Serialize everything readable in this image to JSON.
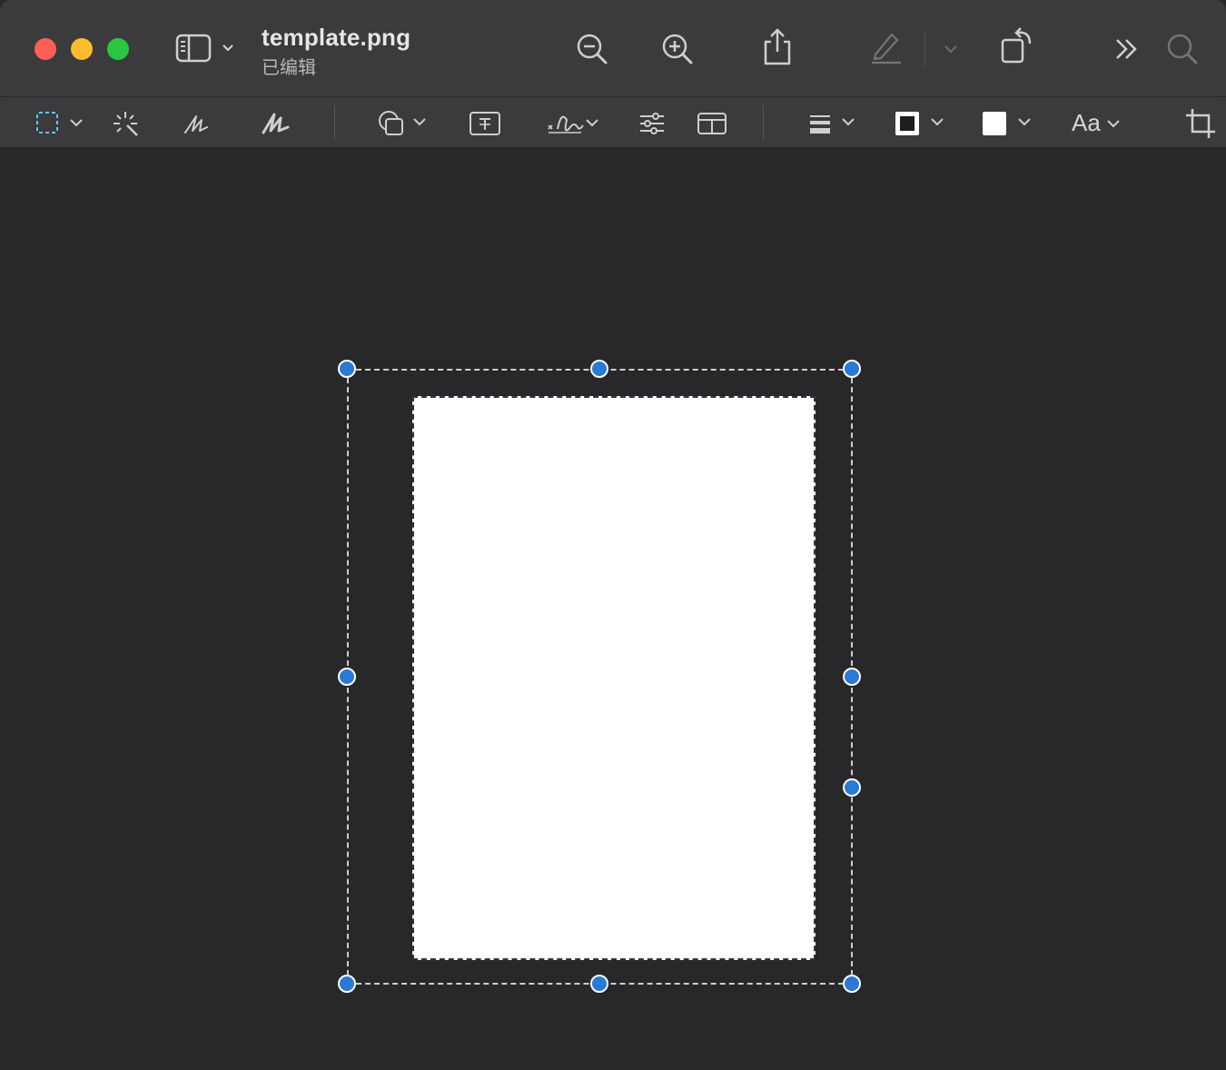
{
  "window": {
    "title": "template.png",
    "subtitle": "已编辑"
  },
  "toolbar": {
    "font_label": "Aa",
    "icons": {
      "sidebar": "sidebar-icon",
      "zoom_out": "zoom-out-icon",
      "zoom_in": "zoom-in-icon",
      "share": "share-icon",
      "markup": "pencil-icon",
      "rotate": "rotate-icon",
      "more": "chevron-double-right-icon",
      "search": "search-icon"
    }
  },
  "markup_toolbar": {
    "tools": [
      "rectangular-selection",
      "instant-alpha",
      "sketch",
      "draw",
      "shapes",
      "text",
      "sign",
      "adjust-color",
      "adjust-size",
      "shape-style",
      "border-color",
      "fill-color",
      "text-style",
      "crop"
    ]
  },
  "colors": {
    "handle": "#2a79d4",
    "close": "#ff5f57",
    "minimize": "#febc2e",
    "maximize": "#28c840"
  }
}
